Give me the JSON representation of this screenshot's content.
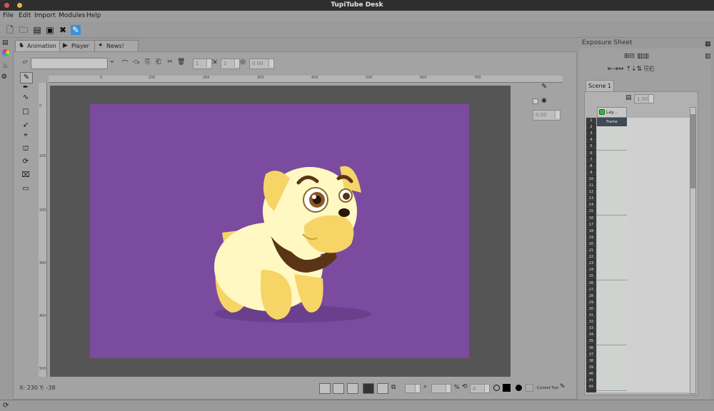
{
  "window": {
    "title": "TupiTube Desk"
  },
  "menu": [
    "File",
    "Edit",
    "Import",
    "Modules",
    "Help"
  ],
  "tabs": [
    "Animation",
    "Player",
    "News!"
  ],
  "brush_bar": {
    "spin_1": "1",
    "spin_2": "1",
    "zoom_value": "0.00"
  },
  "status": {
    "coords": "X: 230 Y: -38"
  },
  "ruler": {
    "h_labels": [
      "0",
      "100",
      "200",
      "300",
      "400",
      "500",
      "600",
      "700"
    ],
    "v_labels": [
      "0",
      "100",
      "200",
      "300",
      "400",
      "500"
    ]
  },
  "tool_options": {
    "value": "0.00"
  },
  "exposure": {
    "title": "Exposure Sheet",
    "scene_tab": "Scene 1",
    "opacity_value": "1.00",
    "layer_name": "Lay...",
    "frame_label": "Frame",
    "rows": [
      "1",
      "2",
      "3",
      "4",
      "5",
      "6",
      "7",
      "8",
      "9",
      "10",
      "11",
      "12",
      "13",
      "14",
      "15",
      "16",
      "17",
      "18",
      "19",
      "20",
      "21",
      "22",
      "23",
      "24",
      "25",
      "26",
      "27",
      "28",
      "29",
      "30",
      "31",
      "32",
      "33",
      "34",
      "35",
      "36",
      "37",
      "38",
      "39",
      "40",
      "41",
      "42"
    ]
  },
  "bottom_bar": {
    "zoom_percent": "%",
    "rotation_value": "0",
    "current_tool_label": "Current Tool"
  },
  "colors": {
    "stage_bg": "#7a4b9e",
    "workspace_bg": "#555555",
    "ui_gray": "#9b9b9b",
    "dog_body": "#fff8c2",
    "dog_accent": "#f6d466",
    "collar": "#5b3416"
  }
}
